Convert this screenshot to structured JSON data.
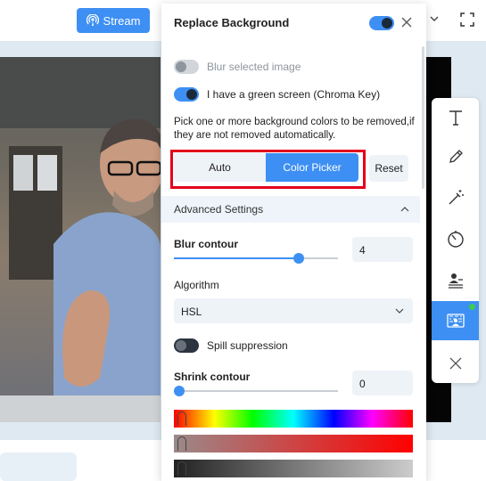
{
  "topbar": {
    "stream_label": "Stream"
  },
  "panel": {
    "title": "Replace Background",
    "blur_selected_label": "Blur selected image",
    "green_screen_label": "I have a green screen (Chroma Key)",
    "description": "Pick one or more background colors to be removed,if they are not removed automatically.",
    "mode_auto": "Auto",
    "mode_color_picker": "Color Picker",
    "reset_label": "Reset",
    "advanced_label": "Advanced Settings",
    "blur_contour_label": "Blur contour",
    "blur_contour_value": "4",
    "blur_contour_level": 0.78,
    "algorithm_label": "Algorithm",
    "algorithm_value": "HSL",
    "spill_label": "Spill suppression",
    "shrink_contour_label": "Shrink contour",
    "shrink_contour_value": "0",
    "shrink_contour_level": 0.0
  },
  "toolbar": {
    "items": [
      "text-tool",
      "pen-tool",
      "magic-wand-tool",
      "timer-tool",
      "presenter-tool",
      "background-tool",
      "close-tool"
    ],
    "active": "background-tool"
  },
  "colors": {
    "accent": "#3d8ff3",
    "highlight": "#e3001b",
    "status": "#3ecc4f"
  }
}
